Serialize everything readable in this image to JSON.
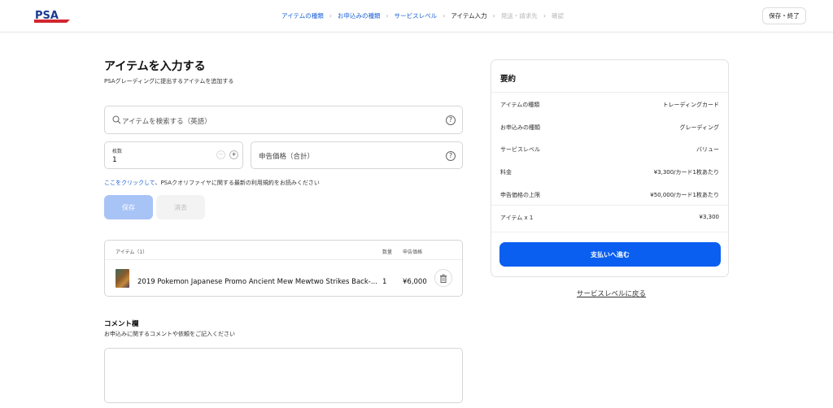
{
  "header": {
    "brand": "PSA",
    "steps": [
      {
        "label": "アイテムの種類",
        "state": "done"
      },
      {
        "label": "お申込みの種類",
        "state": "done"
      },
      {
        "label": "サービスレベル",
        "state": "done"
      },
      {
        "label": "アイテム入力",
        "state": "current"
      },
      {
        "label": "発送・請求先",
        "state": "future"
      },
      {
        "label": "確認",
        "state": "future"
      }
    ],
    "save_exit_label": "保存・終了"
  },
  "main": {
    "title": "アイテムを入力する",
    "subtitle": "PSAグレーディングに提出するアイテムを追加する",
    "search_placeholder": "アイテムを検索する（英語）",
    "quantity_label": "枚数",
    "quantity_value": "1",
    "declared_value_placeholder": "申告価格（合計）",
    "terms_link": "ここをクリックして",
    "terms_text": "、PSAクオリファイヤに関する最新の利用規約をお読みください",
    "save_label": "保存",
    "clear_label": "消去"
  },
  "items_table": {
    "headers": {
      "item": "アイテム（1）",
      "qty": "数量",
      "price": "申告価格"
    },
    "rows": [
      {
        "name": "2019 Pokemon Japanese Promo Ancient Mew Mewtwo Strikes Back-...",
        "qty": "1",
        "price": "¥6,000"
      }
    ]
  },
  "comments": {
    "title": "コメント欄",
    "subtitle": "お申込みに関するコメントや依頼をご記入ください",
    "value": ""
  },
  "summary": {
    "title": "要約",
    "rows": [
      {
        "label": "アイテムの種類",
        "value": "トレーディングカード"
      },
      {
        "label": "お申込みの種類",
        "value": "グレーディング"
      },
      {
        "label": "サービスレベル",
        "value": "バリュー"
      },
      {
        "label": "料金",
        "value": "¥3,300/カード1枚あたり"
      },
      {
        "label": "申告価格の上限",
        "value": "¥50,000/カード1枚あたり"
      },
      {
        "label": "アイテム x 1",
        "value": "¥3,300"
      }
    ],
    "pay_label": "支払いへ進む",
    "back_label": "サービスレベルに戻る"
  },
  "colors": {
    "accent": "#0b5ff0",
    "link": "#1a5fd8",
    "brand_red": "#d22630",
    "brand_blue": "#1a3a8f"
  }
}
